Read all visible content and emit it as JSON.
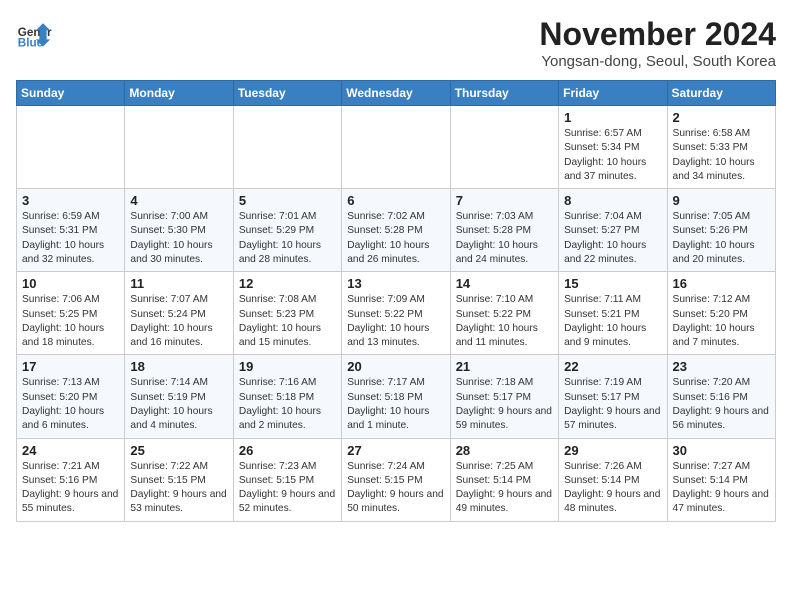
{
  "header": {
    "logo_line1": "General",
    "logo_line2": "Blue",
    "title": "November 2024",
    "subtitle": "Yongsan-dong, Seoul, South Korea"
  },
  "days_of_week": [
    "Sunday",
    "Monday",
    "Tuesday",
    "Wednesday",
    "Thursday",
    "Friday",
    "Saturday"
  ],
  "weeks": [
    {
      "cells": [
        {
          "day": "",
          "info": ""
        },
        {
          "day": "",
          "info": ""
        },
        {
          "day": "",
          "info": ""
        },
        {
          "day": "",
          "info": ""
        },
        {
          "day": "",
          "info": ""
        },
        {
          "day": "1",
          "info": "Sunrise: 6:57 AM\nSunset: 5:34 PM\nDaylight: 10 hours and 37 minutes."
        },
        {
          "day": "2",
          "info": "Sunrise: 6:58 AM\nSunset: 5:33 PM\nDaylight: 10 hours and 34 minutes."
        }
      ]
    },
    {
      "cells": [
        {
          "day": "3",
          "info": "Sunrise: 6:59 AM\nSunset: 5:31 PM\nDaylight: 10 hours and 32 minutes."
        },
        {
          "day": "4",
          "info": "Sunrise: 7:00 AM\nSunset: 5:30 PM\nDaylight: 10 hours and 30 minutes."
        },
        {
          "day": "5",
          "info": "Sunrise: 7:01 AM\nSunset: 5:29 PM\nDaylight: 10 hours and 28 minutes."
        },
        {
          "day": "6",
          "info": "Sunrise: 7:02 AM\nSunset: 5:28 PM\nDaylight: 10 hours and 26 minutes."
        },
        {
          "day": "7",
          "info": "Sunrise: 7:03 AM\nSunset: 5:28 PM\nDaylight: 10 hours and 24 minutes."
        },
        {
          "day": "8",
          "info": "Sunrise: 7:04 AM\nSunset: 5:27 PM\nDaylight: 10 hours and 22 minutes."
        },
        {
          "day": "9",
          "info": "Sunrise: 7:05 AM\nSunset: 5:26 PM\nDaylight: 10 hours and 20 minutes."
        }
      ]
    },
    {
      "cells": [
        {
          "day": "10",
          "info": "Sunrise: 7:06 AM\nSunset: 5:25 PM\nDaylight: 10 hours and 18 minutes."
        },
        {
          "day": "11",
          "info": "Sunrise: 7:07 AM\nSunset: 5:24 PM\nDaylight: 10 hours and 16 minutes."
        },
        {
          "day": "12",
          "info": "Sunrise: 7:08 AM\nSunset: 5:23 PM\nDaylight: 10 hours and 15 minutes."
        },
        {
          "day": "13",
          "info": "Sunrise: 7:09 AM\nSunset: 5:22 PM\nDaylight: 10 hours and 13 minutes."
        },
        {
          "day": "14",
          "info": "Sunrise: 7:10 AM\nSunset: 5:22 PM\nDaylight: 10 hours and 11 minutes."
        },
        {
          "day": "15",
          "info": "Sunrise: 7:11 AM\nSunset: 5:21 PM\nDaylight: 10 hours and 9 minutes."
        },
        {
          "day": "16",
          "info": "Sunrise: 7:12 AM\nSunset: 5:20 PM\nDaylight: 10 hours and 7 minutes."
        }
      ]
    },
    {
      "cells": [
        {
          "day": "17",
          "info": "Sunrise: 7:13 AM\nSunset: 5:20 PM\nDaylight: 10 hours and 6 minutes."
        },
        {
          "day": "18",
          "info": "Sunrise: 7:14 AM\nSunset: 5:19 PM\nDaylight: 10 hours and 4 minutes."
        },
        {
          "day": "19",
          "info": "Sunrise: 7:16 AM\nSunset: 5:18 PM\nDaylight: 10 hours and 2 minutes."
        },
        {
          "day": "20",
          "info": "Sunrise: 7:17 AM\nSunset: 5:18 PM\nDaylight: 10 hours and 1 minute."
        },
        {
          "day": "21",
          "info": "Sunrise: 7:18 AM\nSunset: 5:17 PM\nDaylight: 9 hours and 59 minutes."
        },
        {
          "day": "22",
          "info": "Sunrise: 7:19 AM\nSunset: 5:17 PM\nDaylight: 9 hours and 57 minutes."
        },
        {
          "day": "23",
          "info": "Sunrise: 7:20 AM\nSunset: 5:16 PM\nDaylight: 9 hours and 56 minutes."
        }
      ]
    },
    {
      "cells": [
        {
          "day": "24",
          "info": "Sunrise: 7:21 AM\nSunset: 5:16 PM\nDaylight: 9 hours and 55 minutes."
        },
        {
          "day": "25",
          "info": "Sunrise: 7:22 AM\nSunset: 5:15 PM\nDaylight: 9 hours and 53 minutes."
        },
        {
          "day": "26",
          "info": "Sunrise: 7:23 AM\nSunset: 5:15 PM\nDaylight: 9 hours and 52 minutes."
        },
        {
          "day": "27",
          "info": "Sunrise: 7:24 AM\nSunset: 5:15 PM\nDaylight: 9 hours and 50 minutes."
        },
        {
          "day": "28",
          "info": "Sunrise: 7:25 AM\nSunset: 5:14 PM\nDaylight: 9 hours and 49 minutes."
        },
        {
          "day": "29",
          "info": "Sunrise: 7:26 AM\nSunset: 5:14 PM\nDaylight: 9 hours and 48 minutes."
        },
        {
          "day": "30",
          "info": "Sunrise: 7:27 AM\nSunset: 5:14 PM\nDaylight: 9 hours and 47 minutes."
        }
      ]
    }
  ]
}
